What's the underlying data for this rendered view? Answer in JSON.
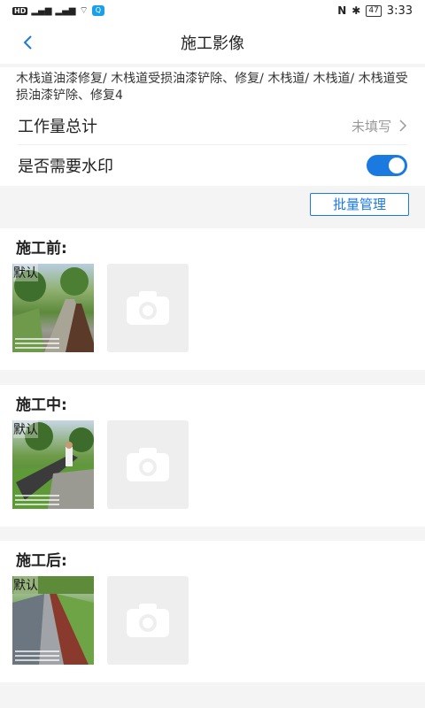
{
  "status_bar": {
    "left_chips": [
      "HD",
      "4G",
      "4G"
    ],
    "time": "3:33",
    "battery": "47"
  },
  "header": {
    "title": "施工影像"
  },
  "description": "木栈道油漆修复/ 木栈道受损油漆铲除、修复/ 木栈道/ 木栈道/ 木栈道受损油漆铲除、修复4",
  "workload": {
    "label": "工作量总计",
    "value": "未填写"
  },
  "watermark": {
    "label": "是否需要水印",
    "enabled": true
  },
  "batch_button": "批量管理",
  "sections": [
    {
      "title": "施工前:",
      "photo_tag": "默认"
    },
    {
      "title": "施工中:",
      "photo_tag": "默认"
    },
    {
      "title": "施工后:",
      "photo_tag": "默认"
    }
  ],
  "icons": {
    "back": "chevron-left-icon",
    "arrow": "chevron-right-icon",
    "camera": "camera-icon"
  },
  "colors": {
    "accent": "#1a7ae0",
    "muted": "#999999"
  }
}
